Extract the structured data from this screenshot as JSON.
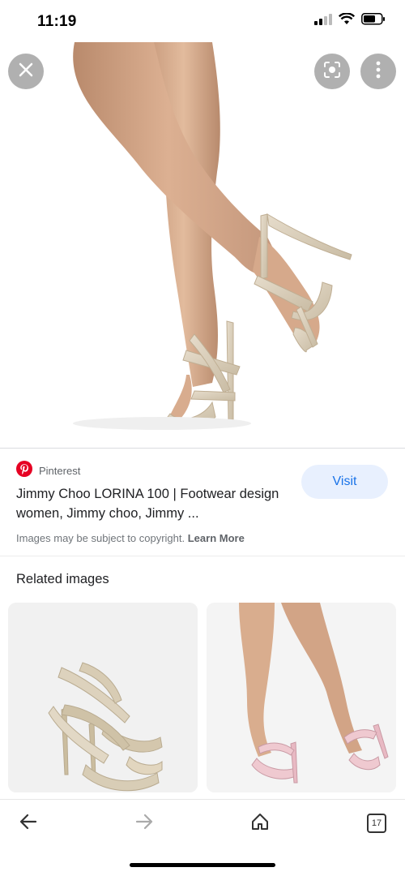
{
  "status_bar": {
    "time": "11:19"
  },
  "result": {
    "source": "Pinterest",
    "title": "Jimmy Choo LORINA 100 | Footwear design women, Jimmy choo, Jimmy ...",
    "visit_label": "Visit",
    "copyright_text": "Images may be subject to copyright.",
    "learn_more_label": "Learn More"
  },
  "related": {
    "heading": "Related images"
  },
  "toolbar": {
    "tab_count": "17"
  },
  "colors": {
    "accent_blue": "#1a73e8",
    "visit_bg": "#e8f0fe",
    "pinterest_red": "#e60023"
  },
  "icons": [
    "close-icon",
    "lens-icon",
    "more-vert-icon",
    "pinterest-icon",
    "back-arrow-icon",
    "forward-arrow-icon",
    "home-icon",
    "tabs-icon",
    "signal-icon",
    "wifi-icon",
    "battery-icon"
  ]
}
